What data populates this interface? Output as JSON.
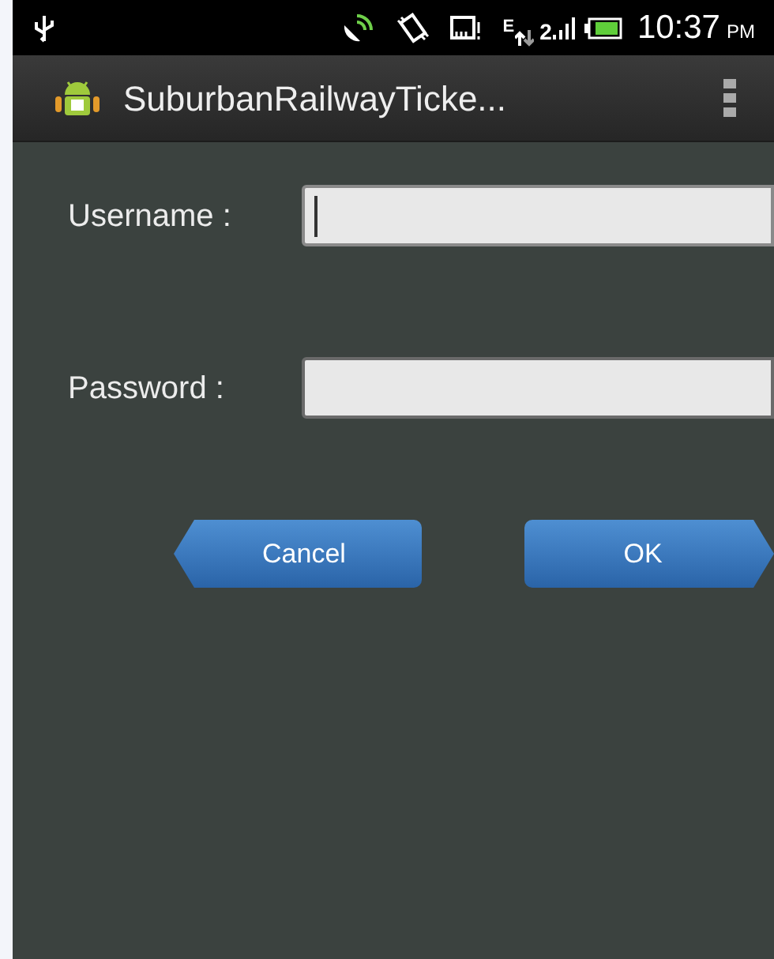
{
  "status_bar": {
    "network_type": "E",
    "sim_slot": "2",
    "time": "10:37",
    "time_suffix": "PM"
  },
  "action_bar": {
    "title": "SuburbanRailwayTicke..."
  },
  "fields": [
    {
      "label": "Username :",
      "focused": true
    },
    {
      "label": "Password :",
      "focused": false
    }
  ],
  "buttons": [
    {
      "label": "Cancel",
      "kind": "back"
    },
    {
      "label": "OK",
      "kind": "forward"
    }
  ]
}
